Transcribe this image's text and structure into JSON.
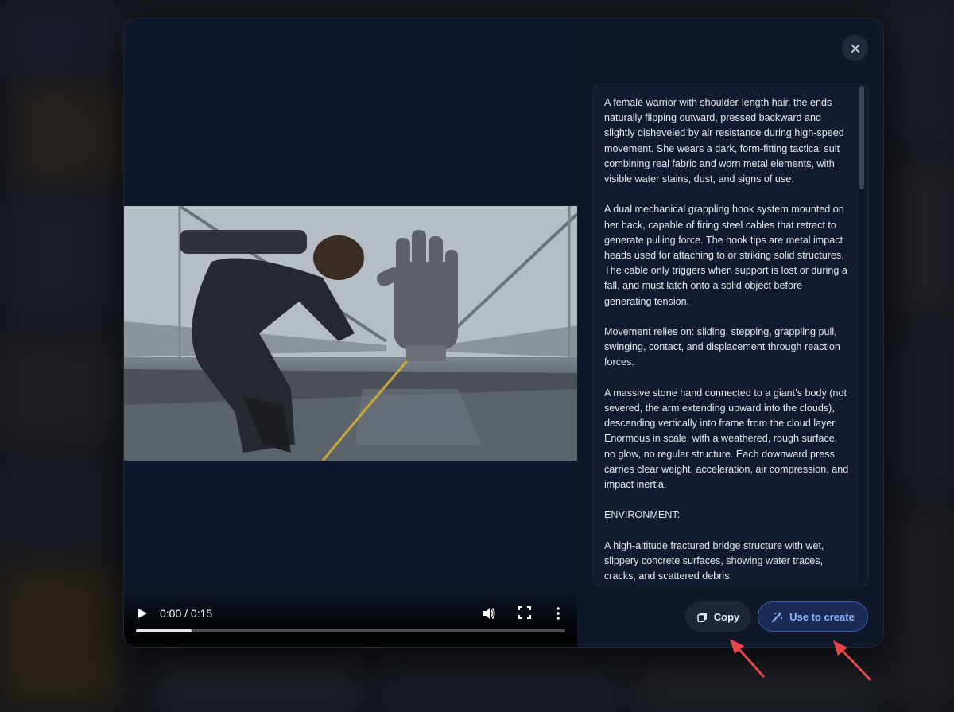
{
  "video": {
    "time_display": "0:00 / 0:15",
    "progress_fraction": 0.13
  },
  "prompt": {
    "paragraphs": [
      "A female warrior with shoulder-length hair, the ends naturally flipping outward, pressed backward and slightly disheveled by air resistance during high-speed movement. She wears a dark, form-fitting tactical suit combining real fabric and worn metal elements, with visible water stains, dust, and signs of use.",
      "A dual mechanical grappling hook system mounted on her back, capable of firing steel cables that retract to generate pulling force. The hook tips are metal impact heads used for attaching to or striking solid structures. The cable only triggers when support is lost or during a fall, and must latch onto a solid object before generating tension.",
      "Movement relies on: sliding, stepping, grappling pull, swinging, contact, and displacement through reaction forces.",
      "A massive stone hand connected to a giant’s body (not severed, the arm extending upward into the clouds), descending vertically into frame from the cloud layer. Enormous in scale, with a weathered, rough surface, no glow, no regular structure. Each downward press carries clear weight, acceleration, air compression, and impact inertia.",
      "ENVIRONMENT:",
      "A high-altitude fractured bridge structure with wet, slippery concrete surfaces, showing water traces, cracks, and scattered debris."
    ]
  },
  "actions": {
    "copy_label": "Copy",
    "create_label": "Use to create"
  },
  "icons": {
    "close": "close-icon",
    "copy": "copy-icon",
    "create": "magic-wand-icon",
    "play": "play-icon",
    "volume": "volume-icon",
    "fullscreen": "fullscreen-icon",
    "more": "more-vertical-icon"
  },
  "colors": {
    "modal_bg": "#0f1729",
    "accent": "#8fb2ff",
    "annotation_arrow": "#e8474a"
  }
}
